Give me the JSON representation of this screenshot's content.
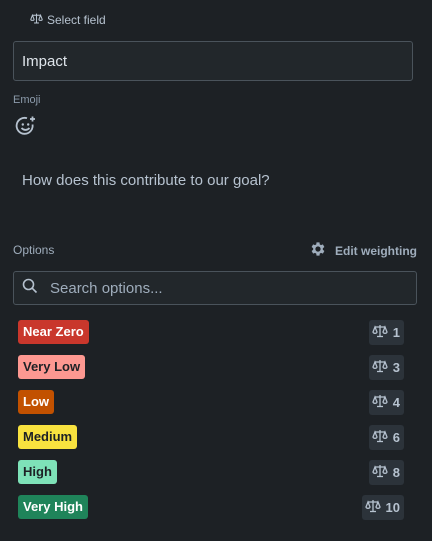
{
  "header": {
    "select_field_label": "Select field",
    "select_field_icon": "scale-icon"
  },
  "field": {
    "name_value": "Impact"
  },
  "emoji": {
    "label": "Emoji",
    "icon": "add-emoji-icon"
  },
  "description": "How does this contribute to our goal?",
  "options_section": {
    "label": "Options",
    "edit_weighting_label": "Edit weighting",
    "edit_weighting_icon": "gear-icon"
  },
  "search": {
    "placeholder": "Search options...",
    "icon": "search-icon"
  },
  "options": [
    {
      "label": "Near Zero",
      "weight": "1",
      "bg": "#c9372c",
      "fg": "#ffffff"
    },
    {
      "label": "Very Low",
      "weight": "3",
      "bg": "#fd9891",
      "fg": "#1d2125"
    },
    {
      "label": "Low",
      "weight": "4",
      "bg": "#c25100",
      "fg": "#ffffff"
    },
    {
      "label": "Medium",
      "weight": "6",
      "bg": "#f8e23f",
      "fg": "#1d2125"
    },
    {
      "label": "High",
      "weight": "8",
      "bg": "#7ee2b8",
      "fg": "#1d2125"
    },
    {
      "label": "Very High",
      "weight": "10",
      "bg": "#1f845a",
      "fg": "#ffffff"
    }
  ]
}
